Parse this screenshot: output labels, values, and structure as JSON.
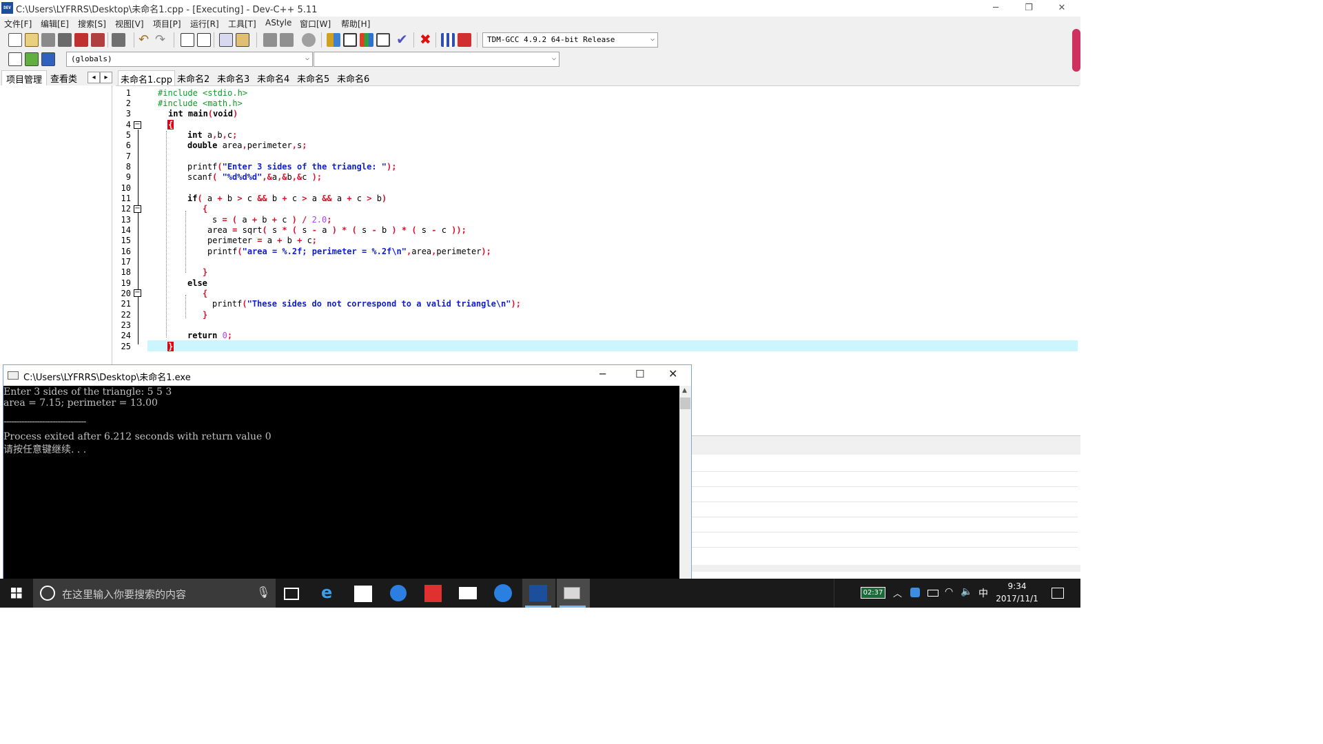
{
  "window": {
    "title": "C:\\Users\\LYFRRS\\Desktop\\未命名1.cpp - [Executing] - Dev-C++ 5.11",
    "app_icon_label": "DEV",
    "minimize": "─",
    "restore": "❐",
    "close": "✕"
  },
  "menu": [
    "文件[F]",
    "编辑[E]",
    "搜索[S]",
    "视图[V]",
    "项目[P]",
    "运行[R]",
    "工具[T]",
    "AStyle",
    "窗口[W]",
    "帮助[H]"
  ],
  "toolbar": {
    "compiler": "TDM-GCC 4.9.2 64-bit Release",
    "scope": "(globals)",
    "symbol": ""
  },
  "left_tabs": [
    "项目管理",
    "查看类"
  ],
  "tab_nav": {
    "prev": "◂",
    "next": "▸"
  },
  "file_tabs": [
    "未命名1.cpp",
    "未命名2",
    "未命名3",
    "未命名4",
    "未命名5",
    "未命名6"
  ],
  "line_numbers": [
    "1",
    "2",
    "3",
    "4",
    "5",
    "6",
    "7",
    "8",
    "9",
    "10",
    "11",
    "12",
    "13",
    "14",
    "15",
    "16",
    "17",
    "18",
    "19",
    "20",
    "21",
    "22",
    "23",
    "24",
    "25"
  ],
  "code": {
    "l1": "#include <stdio.h>",
    "l2": "#include <math.h>",
    "l3a": "int main",
    "l3b": "(",
    "l3c": "void",
    "l3d": ")",
    "l4": "{",
    "l5a": "int ",
    "l5b": "a",
    "l5c": ",",
    "l5d": "b",
    "l5e": ",",
    "l5f": "c",
    "l5g": ";",
    "l6a": "double ",
    "l6b": "area",
    "l6c": ",",
    "l6d": "perimeter",
    "l6e": ",",
    "l6f": "s",
    "l6g": ";",
    "l8a": "printf",
    "l8b": "(",
    "l8c": "\"Enter 3 sides of the triangle: \"",
    "l8d": ");",
    "l9a": "scanf",
    "l9b": "( ",
    "l9c": "\"%d%d%d\"",
    "l9d": ",&",
    "l9e": "a",
    "l9f": ",&",
    "l9g": "b",
    "l9h": ",&",
    "l9i": "c",
    "l9j": " );",
    "l11a": "if",
    "l11b": "( ",
    "l11c": "a",
    "l11d": " + ",
    "l11e": "b",
    "l11f": " > ",
    "l11g": "c",
    "l11h": " && ",
    "l11i": "b",
    "l11j": " + ",
    "l11k": "c",
    "l11l": " > ",
    "l11m": "a",
    "l11n": " && ",
    "l11o": "a",
    "l11p": " + ",
    "l11q": "c",
    "l11r": " > ",
    "l11s": "b",
    "l11t": ")",
    "l12": "{",
    "l13a": "s",
    "l13b": " = ( ",
    "l13c": "a",
    "l13d": " + ",
    "l13e": "b",
    "l13f": " + ",
    "l13g": "c",
    "l13h": " ) / ",
    "l13i": "2.0",
    "l13j": ";",
    "l14a": "area",
    "l14b": " = ",
    "l14c": "sqrt",
    "l14d": "( ",
    "l14e": "s",
    "l14f": " * ( ",
    "l14g": "s",
    "l14h": " - ",
    "l14i": "a",
    "l14j": " ) * ( ",
    "l14k": "s",
    "l14l": " - ",
    "l14m": "b",
    "l14n": " ) * ( ",
    "l14o": "s",
    "l14p": " - ",
    "l14q": "c",
    "l14r": " ));",
    "l15a": "perimeter",
    "l15b": " = ",
    "l15c": "a",
    "l15d": " + ",
    "l15e": "b",
    "l15f": " + ",
    "l15g": "c",
    "l15h": ";",
    "l16a": "printf",
    "l16b": "(",
    "l16c": "\"area = %.2f; perimeter = %.2f\\n\"",
    "l16d": ",",
    "l16e": "area",
    "l16f": ",",
    "l16g": "perimeter",
    "l16h": ");",
    "l18": "}",
    "l19": "else",
    "l20": "{",
    "l21a": "printf",
    "l21b": "(",
    "l21c": "\"These sides do not correspond to a valid triangle\\n\"",
    "l21d": ");",
    "l22": "}",
    "l24a": "return ",
    "l24b": "0",
    "l24c": ";",
    "l25": "}"
  },
  "console": {
    "title": "C:\\Users\\LYFRRS\\Desktop\\未命名1.exe",
    "lines": [
      "Enter 3 sides of the triangle: 5 5 3",
      "area = 7.15; perimeter = 13.00",
      "",
      "--------------------------------",
      "Process exited after 6.212 seconds with return value 0",
      "请按任意键继续. . ."
    ]
  },
  "taskbar": {
    "search_placeholder": "在这里输入你要搜索的内容",
    "battery": "02:37",
    "ime": "中",
    "time": "9:34",
    "date": "2017/11/1"
  }
}
